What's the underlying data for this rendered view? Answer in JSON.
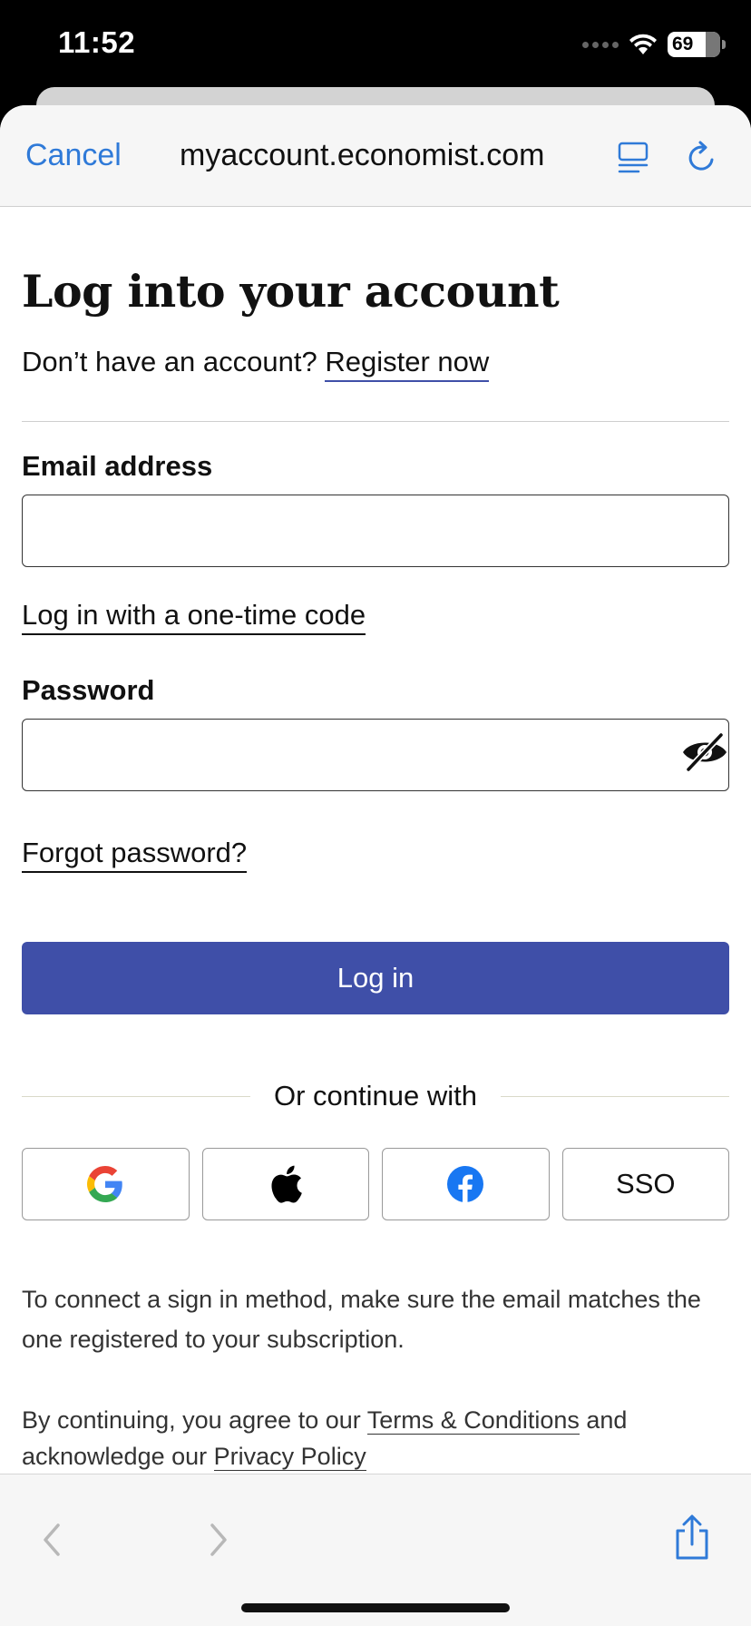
{
  "status_bar": {
    "time": "11:52",
    "battery": "69"
  },
  "nav": {
    "cancel_label": "Cancel",
    "url": "myaccount.economist.com"
  },
  "page": {
    "title": "Log into your account",
    "no_account_text": "Don’t have an account?",
    "register_link": "Register now"
  },
  "email": {
    "label": "Email address",
    "value": "",
    "placeholder": ""
  },
  "one_time_code_link": "Log in with a one-time code",
  "password": {
    "label": "Password",
    "value": "",
    "placeholder": ""
  },
  "forgot_password_link": "Forgot password?",
  "login_button": "Log in",
  "or_continue": "Or continue with",
  "social": [
    {
      "name": "google",
      "icon": "google-icon"
    },
    {
      "name": "apple",
      "icon": "apple-icon"
    },
    {
      "name": "facebook",
      "icon": "facebook-icon"
    },
    {
      "name": "sso",
      "label": "SSO"
    }
  ],
  "note": "To connect a sign in method, make sure the email matches the one registered to your subscription.",
  "legal": {
    "prefix": "By continuing, you agree to our",
    "terms_link": "Terms & Conditions",
    "middle": "and acknowledge our",
    "privacy_link": "Privacy Policy"
  },
  "colors": {
    "accent": "#3f4fa8",
    "safari_blue": "#2f7ad8"
  }
}
